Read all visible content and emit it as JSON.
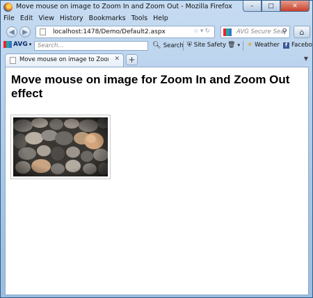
{
  "window": {
    "title": "Move mouse on image to Zoom In and Zoom Out - Mozilla Firefox",
    "controls": {
      "minimize": "–",
      "maximize": "□",
      "close": "✕"
    }
  },
  "menu": [
    "File",
    "Edit",
    "View",
    "History",
    "Bookmarks",
    "Tools",
    "Help"
  ],
  "navbar": {
    "url": "localhost:1478/Demo/Default2.aspx",
    "search_placeholder": "AVG Secure Sear"
  },
  "avg_toolbar": {
    "brand": "AVG",
    "search_placeholder": "Search...",
    "search_label": "Search",
    "site_safety_label": "Site Safety",
    "weather_label": "Weather",
    "facebook_label": "Facebo"
  },
  "tabs": [
    {
      "label": "Move mouse on image to Zoom In and ...",
      "active": true
    }
  ],
  "page": {
    "heading": "Move mouse on image for Zoom In and Zoom Out effect",
    "image_description": "pebbles-photo"
  },
  "colors": {
    "chrome_blue": "#a9c6e6",
    "close_red": "#c8402b"
  }
}
